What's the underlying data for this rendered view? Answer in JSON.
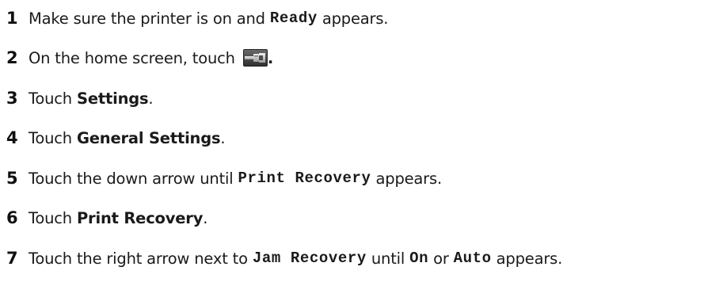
{
  "steps": [
    {
      "num": "1",
      "parts": [
        "Make sure the printer is on and ",
        "Ready",
        " appears."
      ]
    },
    {
      "num": "2",
      "parts": [
        "On the home screen, touch ",
        "."
      ],
      "icon": "settings-wrench-icon"
    },
    {
      "num": "3",
      "parts": [
        "Touch ",
        "Settings",
        "."
      ]
    },
    {
      "num": "4",
      "parts": [
        "Touch ",
        "General Settings",
        "."
      ]
    },
    {
      "num": "5",
      "parts": [
        "Touch the down arrow until ",
        "Print Recovery",
        " appears."
      ]
    },
    {
      "num": "6",
      "parts": [
        "Touch ",
        "Print Recovery",
        "."
      ]
    },
    {
      "num": "7",
      "parts": [
        "Touch the right arrow next to ",
        "Jam Recovery",
        " until ",
        "On",
        " or ",
        "Auto",
        " appears."
      ]
    }
  ]
}
